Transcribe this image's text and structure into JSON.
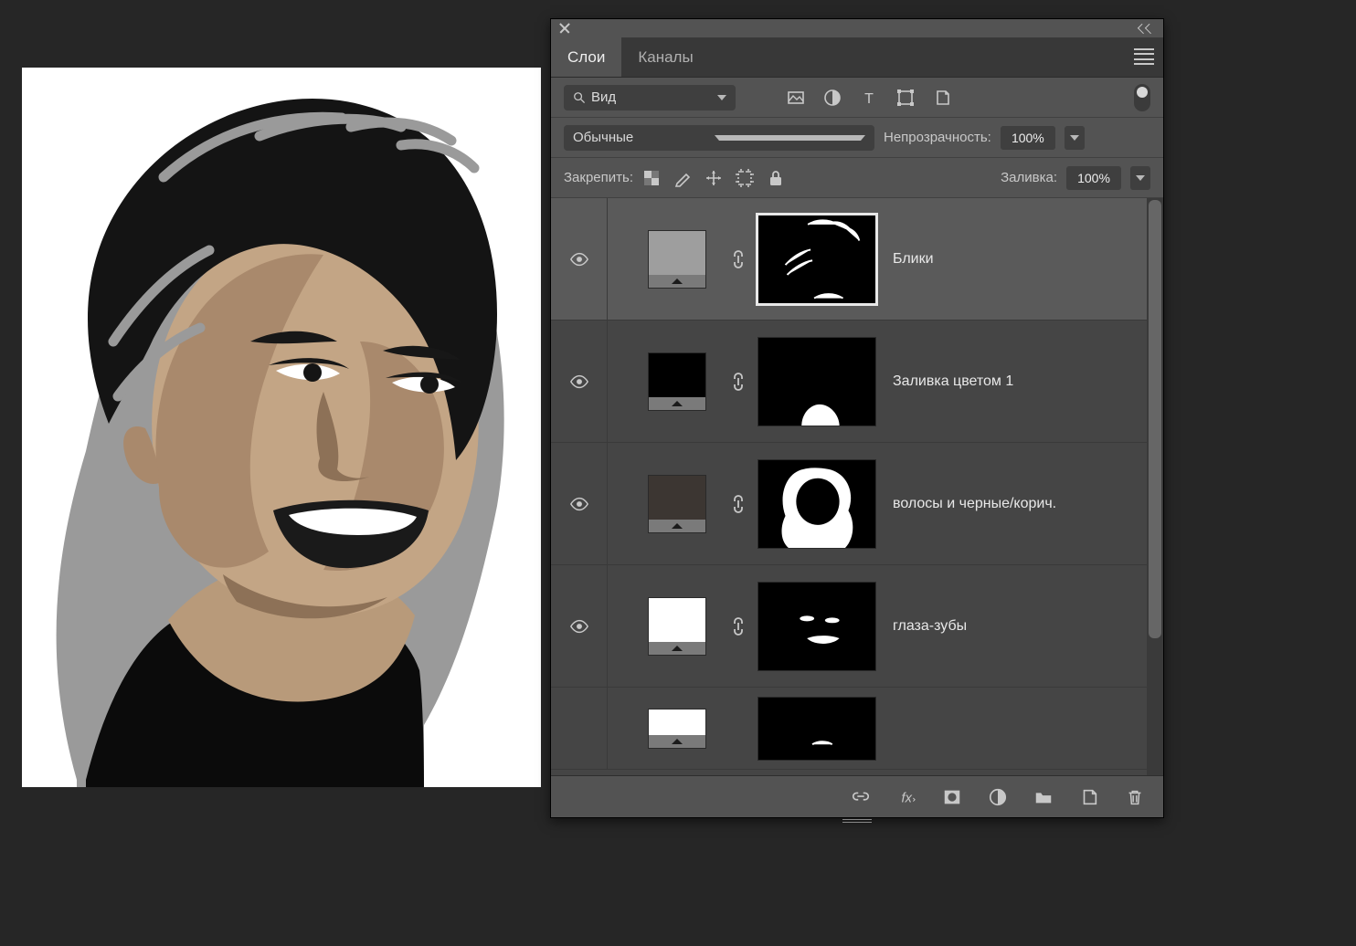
{
  "tabs": {
    "layers": "Слои",
    "channels": "Каналы"
  },
  "filter": {
    "search_label": "Вид"
  },
  "blend": {
    "mode": "Обычные",
    "opacity_label": "Непрозрачность:",
    "opacity_value": "100%"
  },
  "lock": {
    "label": "Закрепить:",
    "fill_label": "Заливка:",
    "fill_value": "100%"
  },
  "layers": [
    {
      "name": "Блики",
      "swatch": "#9e9e9e",
      "selected": true
    },
    {
      "name": "Заливка цветом 1",
      "swatch": "#000000",
      "selected": false
    },
    {
      "name": "волосы и черные/корич.",
      "swatch": "#3c3632",
      "selected": false
    },
    {
      "name": "глаза-зубы",
      "swatch": "#ffffff",
      "selected": false
    },
    {
      "name": "",
      "swatch": "#ffffff",
      "selected": false
    }
  ]
}
